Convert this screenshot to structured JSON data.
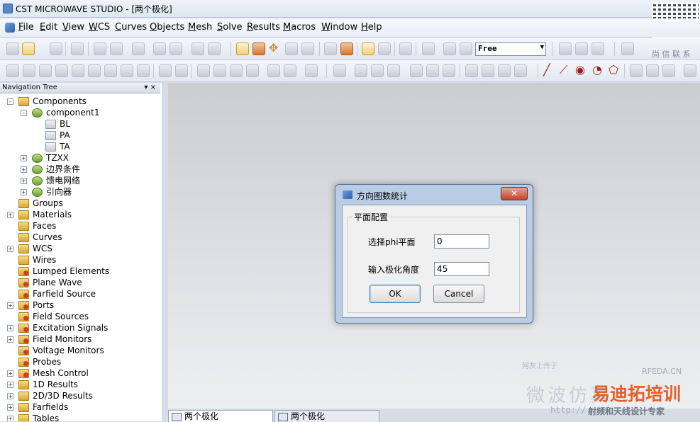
{
  "window": {
    "title": "CST MICROWAVE STUDIO - [两个极化]",
    "qr_icon": "qr-code"
  },
  "menu": {
    "items": [
      "File",
      "Edit",
      "View",
      "WCS",
      "Curves",
      "Objects",
      "Mesh",
      "Solve",
      "Results",
      "Macros",
      "Window",
      "Help"
    ]
  },
  "toolbar": {
    "mode_select": "Free",
    "side_text": "尚 信 联 系"
  },
  "nav": {
    "title": "Navigation Tree",
    "controls": "▾ ×",
    "items": [
      {
        "label": "Components",
        "expander": "-",
        "icon": "folder"
      },
      {
        "label": "component1",
        "expander": "-",
        "icon": "component"
      },
      {
        "label": "BL",
        "expander": "",
        "icon": "solid"
      },
      {
        "label": "PA",
        "expander": "",
        "icon": "solid"
      },
      {
        "label": "TA",
        "expander": "",
        "icon": "solid"
      },
      {
        "label": "TZXX",
        "expander": "+",
        "icon": "component"
      },
      {
        "label": "边界条件",
        "expander": "+",
        "icon": "component"
      },
      {
        "label": "馈电网络",
        "expander": "+",
        "icon": "component"
      },
      {
        "label": "引向器",
        "expander": "+",
        "icon": "component"
      },
      {
        "label": "Groups",
        "expander": "",
        "icon": "folder"
      },
      {
        "label": "Materials",
        "expander": "+",
        "icon": "folder"
      },
      {
        "label": "Faces",
        "expander": "",
        "icon": "folder"
      },
      {
        "label": "Curves",
        "expander": "",
        "icon": "folder"
      },
      {
        "label": "WCS",
        "expander": "+",
        "icon": "folder"
      },
      {
        "label": "Wires",
        "expander": "",
        "icon": "folder"
      },
      {
        "label": "Lumped Elements",
        "expander": "",
        "icon": "red-folder"
      },
      {
        "label": "Plane Wave",
        "expander": "",
        "icon": "red-folder"
      },
      {
        "label": "Farfield Source",
        "expander": "",
        "icon": "red-folder"
      },
      {
        "label": "Ports",
        "expander": "+",
        "icon": "red-folder"
      },
      {
        "label": "Field Sources",
        "expander": "",
        "icon": "red-folder"
      },
      {
        "label": "Excitation Signals",
        "expander": "+",
        "icon": "red-folder"
      },
      {
        "label": "Field Monitors",
        "expander": "+",
        "icon": "red-folder"
      },
      {
        "label": "Voltage Monitors",
        "expander": "",
        "icon": "red-folder"
      },
      {
        "label": "Probes",
        "expander": "",
        "icon": "red-folder"
      },
      {
        "label": "Mesh Control",
        "expander": "+",
        "icon": "red-folder"
      },
      {
        "label": "1D Results",
        "expander": "+",
        "icon": "folder"
      },
      {
        "label": "2D/3D Results",
        "expander": "+",
        "icon": "folder"
      },
      {
        "label": "Farfields",
        "expander": "+",
        "icon": "folder"
      },
      {
        "label": "Tables",
        "expander": "+",
        "icon": "folder"
      }
    ]
  },
  "dialog": {
    "title": "方向图数统计",
    "close_label": "✕",
    "group_label": "平面配置",
    "phi_label": "选择phi平面",
    "phi_value": "0",
    "pol_label": "输入极化角度",
    "pol_value": "45",
    "ok_label": "OK",
    "cancel_label": "Cancel"
  },
  "doc_tabs": [
    "两个极化",
    "两个极化"
  ],
  "watermarks": {
    "top_text": "网友上传于",
    "url": "RFEDA.CN",
    "big": "微波仿真",
    "brand": "易迪拓培训",
    "site": "http://",
    "tagline": "射频和天线设计专家"
  }
}
